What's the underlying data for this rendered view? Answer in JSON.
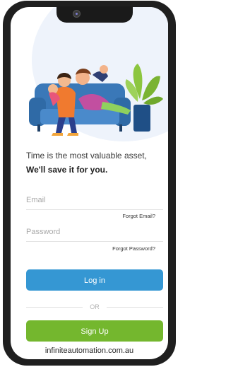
{
  "tagline": {
    "line1": "Time is the most valuable asset,",
    "line2": "We'll save it for you."
  },
  "form": {
    "email_placeholder": "Email",
    "forgot_email": "Forgot Email?",
    "password_placeholder": "Password",
    "forgot_password": "Forgot Password?"
  },
  "actions": {
    "login_label": "Log in",
    "or_label": "OR",
    "signup_label": "Sign Up"
  },
  "footer": {
    "website": "infiniteautomation.com.au"
  },
  "colors": {
    "login_button": "#3597d3",
    "signup_button": "#74b72e",
    "sofa": "#3a78b8",
    "background_blob": "#eef3fb"
  },
  "icons": [
    "camera-icon"
  ]
}
